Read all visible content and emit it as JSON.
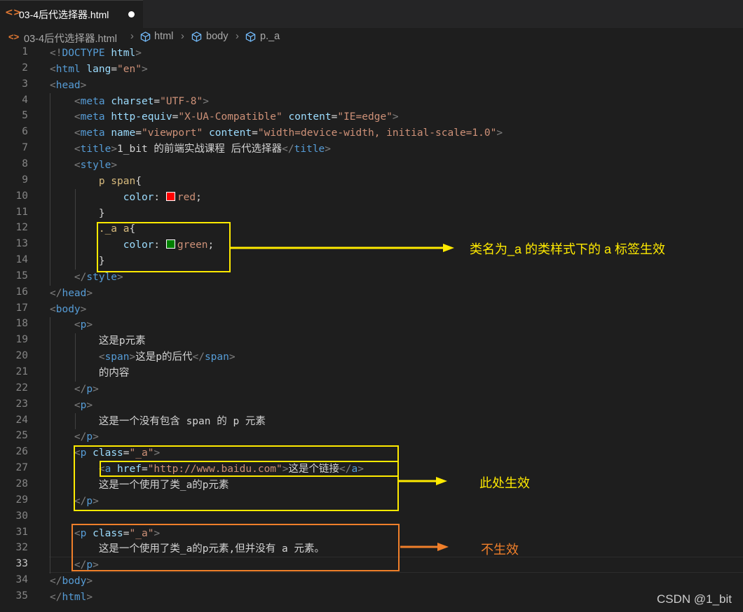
{
  "tab": {
    "icon": "html-file-icon",
    "label": "03-4后代选择器.html"
  },
  "breadcrumb": [
    {
      "label": "03-4后代选择器.html",
      "icon": "html-file-icon"
    },
    {
      "label": "html",
      "icon": "cube-icon"
    },
    {
      "label": "body",
      "icon": "cube-icon"
    },
    {
      "label": "p._a",
      "icon": "cube-icon"
    }
  ],
  "line_numbers": [
    "1",
    "2",
    "3",
    "4",
    "5",
    "6",
    "7",
    "8",
    "9",
    "10",
    "11",
    "12",
    "13",
    "14",
    "15",
    "16",
    "17",
    "18",
    "19",
    "20",
    "21",
    "22",
    "23",
    "24",
    "25",
    "26",
    "27",
    "28",
    "29",
    "30",
    "31",
    "32",
    "33",
    "34",
    "35"
  ],
  "active_line": "33",
  "code": [
    [
      [
        "b",
        "<!"
      ],
      [
        "tag",
        "DOCTYPE"
      ],
      [
        "t",
        " "
      ],
      [
        "attr",
        "html"
      ],
      [
        "b",
        ">"
      ]
    ],
    [
      [
        "b",
        "<"
      ],
      [
        "tag",
        "html"
      ],
      [
        "t",
        " "
      ],
      [
        "attr",
        "lang"
      ],
      [
        "t",
        "="
      ],
      [
        "val",
        "\"en\""
      ],
      [
        "b",
        ">"
      ]
    ],
    [
      [
        "b",
        "<"
      ],
      [
        "tag",
        "head"
      ],
      [
        "b",
        ">"
      ]
    ],
    [
      [
        "t",
        "    "
      ],
      [
        "b",
        "<"
      ],
      [
        "tag",
        "meta"
      ],
      [
        "t",
        " "
      ],
      [
        "attr",
        "charset"
      ],
      [
        "t",
        "="
      ],
      [
        "val",
        "\"UTF-8\""
      ],
      [
        "b",
        ">"
      ]
    ],
    [
      [
        "t",
        "    "
      ],
      [
        "b",
        "<"
      ],
      [
        "tag",
        "meta"
      ],
      [
        "t",
        " "
      ],
      [
        "attr",
        "http-equiv"
      ],
      [
        "t",
        "="
      ],
      [
        "val",
        "\"X-UA-Compatible\""
      ],
      [
        "t",
        " "
      ],
      [
        "attr",
        "content"
      ],
      [
        "t",
        "="
      ],
      [
        "val",
        "\"IE=edge\""
      ],
      [
        "b",
        ">"
      ]
    ],
    [
      [
        "t",
        "    "
      ],
      [
        "b",
        "<"
      ],
      [
        "tag",
        "meta"
      ],
      [
        "t",
        " "
      ],
      [
        "attr",
        "name"
      ],
      [
        "t",
        "="
      ],
      [
        "val",
        "\"viewport\""
      ],
      [
        "t",
        " "
      ],
      [
        "attr",
        "content"
      ],
      [
        "t",
        "="
      ],
      [
        "val",
        "\"width=device-width, initial-scale=1.0\""
      ],
      [
        "b",
        ">"
      ]
    ],
    [
      [
        "t",
        "    "
      ],
      [
        "b",
        "<"
      ],
      [
        "tag",
        "title"
      ],
      [
        "b",
        ">"
      ],
      [
        "t",
        "1_bit 的前端实战课程 后代选择器"
      ],
      [
        "b",
        "</"
      ],
      [
        "tag",
        "title"
      ],
      [
        "b",
        ">"
      ]
    ],
    [
      [
        "t",
        "    "
      ],
      [
        "b",
        "<"
      ],
      [
        "tag",
        "style"
      ],
      [
        "b",
        ">"
      ]
    ],
    [
      [
        "t",
        "        "
      ],
      [
        "sel",
        "p span"
      ],
      [
        "t",
        "{"
      ]
    ],
    [
      [
        "t",
        "            "
      ],
      [
        "attr",
        "color"
      ],
      [
        "t",
        ": "
      ],
      [
        "swatch",
        "#ff0000"
      ],
      [
        "val",
        "red"
      ],
      [
        "t",
        ";"
      ]
    ],
    [
      [
        "t",
        "        }"
      ]
    ],
    [
      [
        "t",
        "        "
      ],
      [
        "sel",
        "._a a"
      ],
      [
        "t",
        "{"
      ]
    ],
    [
      [
        "t",
        "            "
      ],
      [
        "attr",
        "color"
      ],
      [
        "t",
        ": "
      ],
      [
        "swatch",
        "#008000"
      ],
      [
        "val",
        "green"
      ],
      [
        "t",
        ";"
      ]
    ],
    [
      [
        "t",
        "        }"
      ]
    ],
    [
      [
        "t",
        "    "
      ],
      [
        "b",
        "</"
      ],
      [
        "tag",
        "style"
      ],
      [
        "b",
        ">"
      ]
    ],
    [
      [
        "b",
        "</"
      ],
      [
        "tag",
        "head"
      ],
      [
        "b",
        ">"
      ]
    ],
    [
      [
        "b",
        "<"
      ],
      [
        "tag",
        "body"
      ],
      [
        "b",
        ">"
      ]
    ],
    [
      [
        "t",
        "    "
      ],
      [
        "b",
        "<"
      ],
      [
        "tag",
        "p"
      ],
      [
        "b",
        ">"
      ]
    ],
    [
      [
        "t",
        "        这是p元素"
      ]
    ],
    [
      [
        "t",
        "        "
      ],
      [
        "b",
        "<"
      ],
      [
        "tag",
        "span"
      ],
      [
        "b",
        ">"
      ],
      [
        "t",
        "这是p的后代"
      ],
      [
        "b",
        "</"
      ],
      [
        "tag",
        "span"
      ],
      [
        "b",
        ">"
      ]
    ],
    [
      [
        "t",
        "        的内容"
      ]
    ],
    [
      [
        "t",
        "    "
      ],
      [
        "b",
        "</"
      ],
      [
        "tag",
        "p"
      ],
      [
        "b",
        ">"
      ]
    ],
    [
      [
        "t",
        "    "
      ],
      [
        "b",
        "<"
      ],
      [
        "tag",
        "p"
      ],
      [
        "b",
        ">"
      ]
    ],
    [
      [
        "t",
        "        这是一个没有包含 span 的 p 元素"
      ]
    ],
    [
      [
        "t",
        "    "
      ],
      [
        "b",
        "</"
      ],
      [
        "tag",
        "p"
      ],
      [
        "b",
        ">"
      ]
    ],
    [
      [
        "t",
        "    "
      ],
      [
        "b",
        "<"
      ],
      [
        "tag",
        "p"
      ],
      [
        "t",
        " "
      ],
      [
        "attr",
        "class"
      ],
      [
        "t",
        "="
      ],
      [
        "val",
        "\"_a\""
      ],
      [
        "b",
        ">"
      ]
    ],
    [
      [
        "t",
        "        "
      ],
      [
        "b",
        "<"
      ],
      [
        "tag",
        "a"
      ],
      [
        "t",
        " "
      ],
      [
        "attr",
        "href"
      ],
      [
        "t",
        "="
      ],
      [
        "val",
        "\"http://www.baidu.com\""
      ],
      [
        "b",
        ">"
      ],
      [
        "t",
        "这是个链接"
      ],
      [
        "b",
        "</"
      ],
      [
        "tag",
        "a"
      ],
      [
        "b",
        ">"
      ]
    ],
    [
      [
        "t",
        "        这是一个使用了类_a的p元素"
      ]
    ],
    [
      [
        "t",
        "    "
      ],
      [
        "b",
        "</"
      ],
      [
        "tag",
        "p"
      ],
      [
        "b",
        ">"
      ]
    ],
    [
      [
        "t",
        ""
      ]
    ],
    [
      [
        "t",
        "    "
      ],
      [
        "b",
        "<"
      ],
      [
        "tag",
        "p"
      ],
      [
        "t",
        " "
      ],
      [
        "attr",
        "class"
      ],
      [
        "t",
        "="
      ],
      [
        "val",
        "\"_a\""
      ],
      [
        "b",
        ">"
      ]
    ],
    [
      [
        "t",
        "        这是一个使用了类_a的p元素,但并没有 a 元素。"
      ]
    ],
    [
      [
        "t",
        "    "
      ],
      [
        "b",
        "</"
      ],
      [
        "tag",
        "p"
      ],
      [
        "b",
        ">"
      ]
    ],
    [
      [
        "b",
        "</"
      ],
      [
        "tag",
        "body"
      ],
      [
        "b",
        ">"
      ]
    ],
    [
      [
        "b",
        "</"
      ],
      [
        "tag",
        "html"
      ],
      [
        "b",
        ">"
      ]
    ]
  ],
  "annotations": {
    "note1": "类名为_a 的类样式下的 a 标签生效",
    "note2": "此处生效",
    "note3": "不生效",
    "yellow": "#ffea00",
    "orange": "#f07f2a"
  },
  "watermark": "CSDN @1_bit"
}
